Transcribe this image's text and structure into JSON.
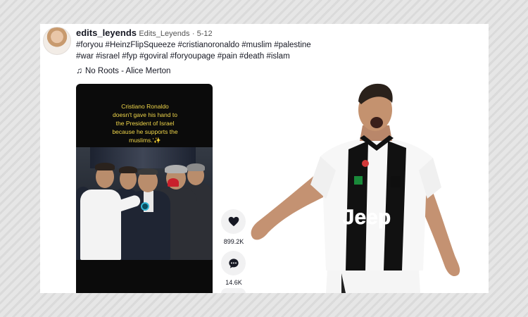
{
  "post": {
    "username": "edits_leyends",
    "nickname": "Edits_Leyends",
    "date": "5-12",
    "hashtags_line1": "#foryou #HeinzFlipSqueeze #cristianoronaldo #muslim #palestine",
    "hashtags_line2": "#war #israel #fyp #goviral #foryoupage #pain #death #islam",
    "music": "No Roots - Alice Merton"
  },
  "video": {
    "caption_lines": [
      "Cristiano Ronaldo",
      "doesn't gave his hand to",
      "the President of Israel",
      "because he supports the",
      "muslims.'✨"
    ]
  },
  "actions": {
    "likes": "899.2K",
    "comments": "14.6K"
  },
  "photo": {
    "jersey_text": "Jeep"
  },
  "colors": {
    "caption": "#f0d64a",
    "highlight_ring": "#32b6d6"
  }
}
